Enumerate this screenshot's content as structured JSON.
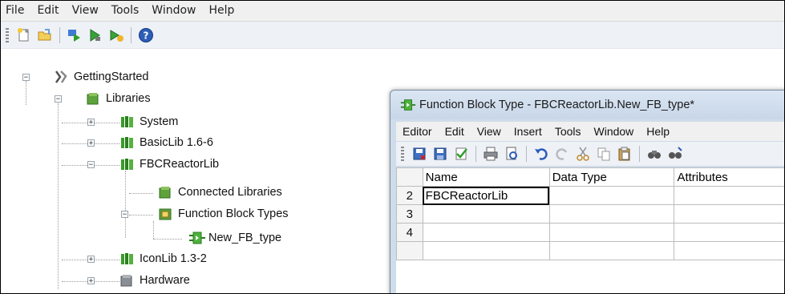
{
  "menubar": {
    "items": [
      "File",
      "Edit",
      "View",
      "Tools",
      "Window",
      "Help"
    ]
  },
  "toolbar": {
    "buttons": [
      "new-icon",
      "open-icon",
      "download-icon",
      "go-online-icon",
      "go-offline-icon",
      "help-icon"
    ]
  },
  "tree": {
    "root": "GettingStarted",
    "libraries": "Libraries",
    "system": "System",
    "basiclib": "BasicLib 1.6-6",
    "fbcreactorlib": "FBCReactorLib",
    "connected_libraries": "Connected Libraries",
    "function_block_types": "Function Block Types",
    "new_fb_type": "New_FB_type",
    "iconlib": "IconLib 1.3-2",
    "hardware": "Hardware"
  },
  "fb_window": {
    "title": "Function Block Type - FBCReactorLib.New_FB_type*",
    "menu": [
      "Editor",
      "Edit",
      "View",
      "Insert",
      "Tools",
      "Window",
      "Help"
    ],
    "grid": {
      "columns": [
        "Name",
        "Data Type",
        "Attributes"
      ],
      "rows": [
        {
          "num": "2",
          "name": "FBCReactorLib",
          "type": "",
          "attrs": ""
        },
        {
          "num": "3",
          "name": "",
          "type": "",
          "attrs": ""
        },
        {
          "num": "4",
          "name": "",
          "type": "",
          "attrs": ""
        }
      ]
    }
  },
  "colors": {
    "accent": "#2b7bd1",
    "library_green": "#3a9b2a",
    "window_frame": "#cfdcea"
  }
}
